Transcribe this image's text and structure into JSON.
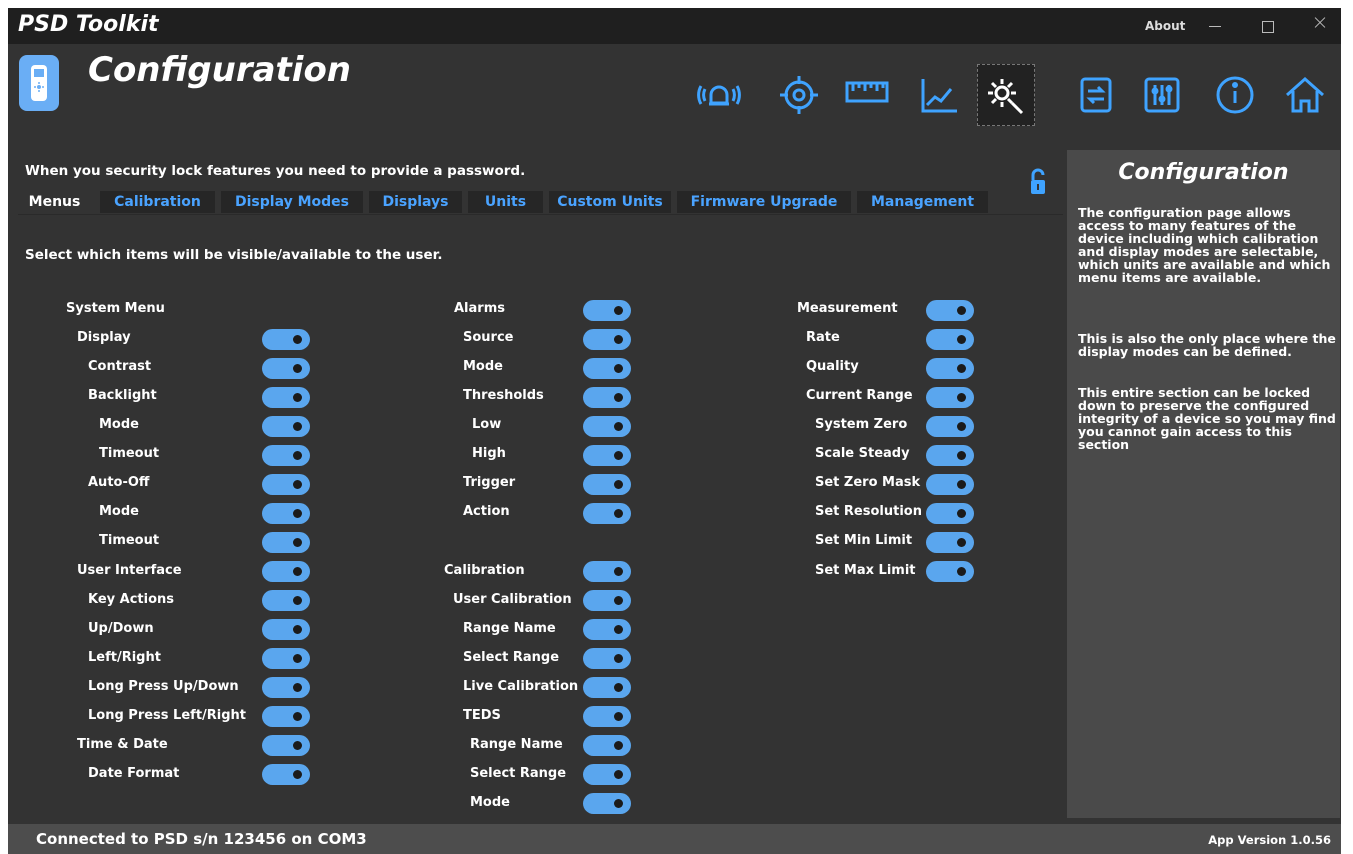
{
  "window": {
    "title": "PSD Toolkit",
    "about_label": "About"
  },
  "page": {
    "title": "Configuration"
  },
  "nav_icons": [
    "alarm-icon",
    "target-icon",
    "ruler-icon",
    "chart-icon",
    "settings-icon",
    "transfer-icon",
    "sliders-icon",
    "info-icon",
    "home-icon"
  ],
  "lock_message": "When you security lock features you need to provide a password.",
  "tabs": [
    "Menus",
    "Calibration",
    "Display Modes",
    "Displays",
    "Units",
    "Custom Units",
    "Firmware Upgrade",
    "Management"
  ],
  "active_tab": "Menus",
  "instructions": "Select which items will be visible/available to the user.",
  "col1": [
    "System Menu",
    "Display",
    "Contrast",
    "Backlight",
    "Mode",
    "Timeout",
    "Auto-Off",
    "Mode",
    "Timeout",
    "User Interface",
    "Key Actions",
    "Up/Down",
    "Left/Right",
    "Long Press Up/Down",
    "Long Press Left/Right",
    "Time & Date",
    "Date Format"
  ],
  "col2a": [
    "Alarms",
    "Source",
    "Mode",
    "Thresholds",
    "Low",
    "High",
    "Trigger",
    "Action"
  ],
  "col2b": [
    "Calibration",
    "User Calibration",
    "Range Name",
    "Select Range",
    "Live Calibration",
    "TEDS",
    "Range Name",
    "Select Range",
    "Mode"
  ],
  "col3": [
    "Measurement",
    "Rate",
    "Quality",
    "Current Range",
    "System Zero",
    "Scale Steady",
    "Set Zero Mask",
    "Set Resolution",
    "Set Min Limit",
    "Set Max Limit"
  ],
  "help": {
    "title": "Configuration",
    "paragraphs": [
      "The configuration page allows access to many features of the device including which calibration and display modes are selectable, which units are available and which menu items are available.",
      "This is also the only place where the display modes can be defined.",
      "This entire section can be locked down to preserve the configured integrity of a device so you may find you cannot gain access to this section"
    ]
  },
  "status": {
    "connection": "Connected to PSD s/n 123456 on COM3",
    "version": "App Version 1.0.56"
  },
  "colors": {
    "accent": "#4aa3ff",
    "toggle_on": "#5aa6ee",
    "background": "#333333"
  }
}
